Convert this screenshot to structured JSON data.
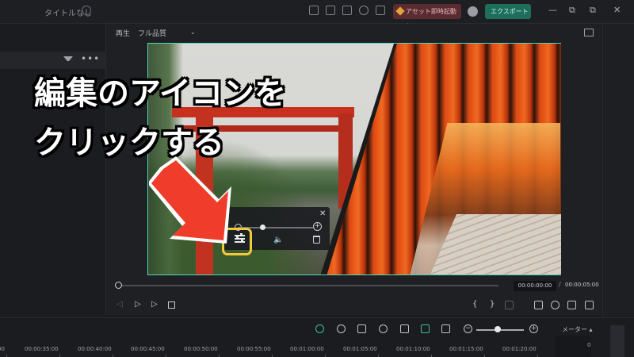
{
  "titlebar": {
    "doc_title": "タイトルなし",
    "asset_button": "アセット即時起動し",
    "export_button": "エクスポート ⌄",
    "window_controls": [
      "—",
      "⧉",
      "✕"
    ]
  },
  "player": {
    "label": "再生",
    "quality": "フル品質",
    "quality_caret": "⌄",
    "overlay_line1": "編集のアイコンを",
    "overlay_line2": "クリックする",
    "mini_toolbar": {
      "close": "✕",
      "plus": "+",
      "speaker": "🔈"
    },
    "time_current": "00:00:00:00",
    "time_separator": "/",
    "time_total": "00:00:05:00",
    "controls": {
      "prev_frame": "◁",
      "play_step": "▷",
      "play": "▷",
      "brace_open": "{",
      "brace_close": "}"
    },
    "colors": {
      "selection": "#55d6b9",
      "highlight": "#f3c93a",
      "arrow": "#f03c2b"
    }
  },
  "left_panel": {
    "more": "•••"
  },
  "timeline": {
    "meter_label": "メーター ▴",
    "meter_zero": "0",
    "zoom_minus": "−",
    "zoom_plus": "+",
    "ruler": [
      "00:00:35:00",
      "00:00:40:00",
      "00:00:45:00",
      "00:00:50:00",
      "00:00:55:00",
      "00:01:00:00",
      "00:01:05:00",
      "00:01:10:00",
      "00:01:15:00",
      "00:01:20:00"
    ],
    "ruler_first_partial": "00"
  }
}
